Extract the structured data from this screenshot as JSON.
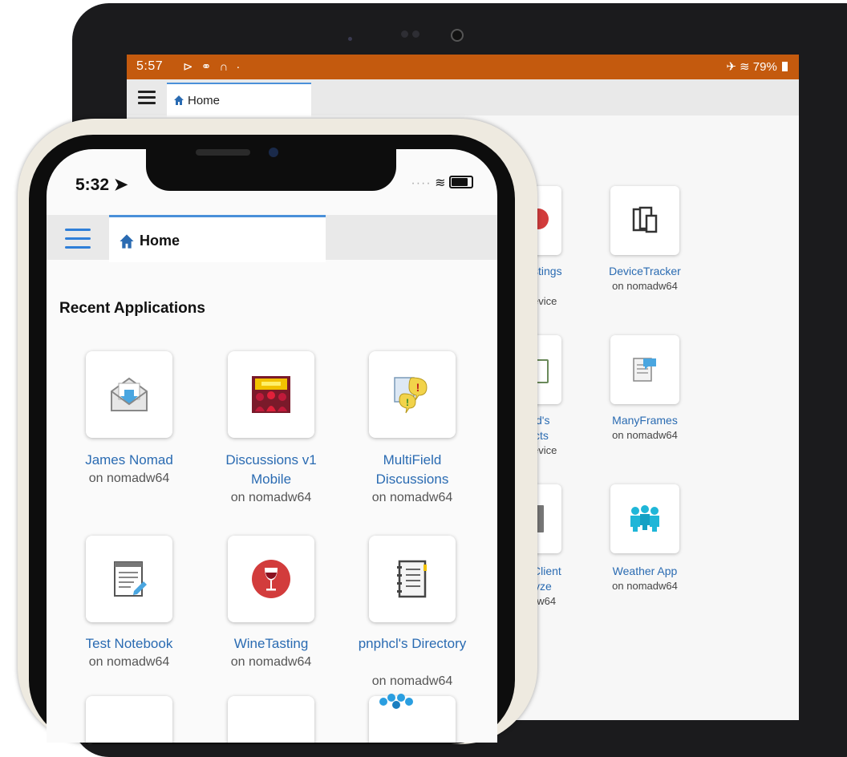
{
  "tablet": {
    "status": {
      "time": "5:57",
      "left_icons": "⊳ ⚭ ∩ ·",
      "right": "79%"
    },
    "tab_label": "Home",
    "apps": [
      {
        "name": "DeviceTracker",
        "sub": "on nomadw64",
        "icon": "devices-icon"
      },
      {
        "name": "ManyFrames",
        "sub": "on nomadw64",
        "icon": "frames-icon"
      },
      {
        "name": "Weather App",
        "sub": "on nomadw64",
        "icon": "people-icon"
      }
    ],
    "partial_labels": [
      "stings",
      "evice",
      "d's",
      "cts",
      "evice",
      "Client",
      "yze",
      "dw64"
    ]
  },
  "phone": {
    "status": {
      "time": "5:32"
    },
    "tab_label": "Home",
    "section_title": "Recent Applications",
    "apps": [
      {
        "name": "James Nomad",
        "sub": "on nomadw64",
        "icon": "envelope-icon"
      },
      {
        "name": "Discussions v1 Mobile",
        "sub": "on nomadw64",
        "icon": "audience-icon"
      },
      {
        "name": "MultiField Discussions",
        "sub": "on nomadw64",
        "icon": "chat-alert-icon"
      },
      {
        "name": "Test Notebook",
        "sub": "on nomadw64",
        "icon": "notebook-icon"
      },
      {
        "name": "WineTasting",
        "sub": "on nomadw64",
        "icon": "wine-icon"
      },
      {
        "name": "pnphcl's Directory",
        "sub": "on nomadw64",
        "icon": "directory-icon"
      }
    ]
  },
  "colors": {
    "tablet_status_bar": "#c45a0e",
    "link": "#2a6bb2",
    "tab_accent": "#4a90d9"
  }
}
